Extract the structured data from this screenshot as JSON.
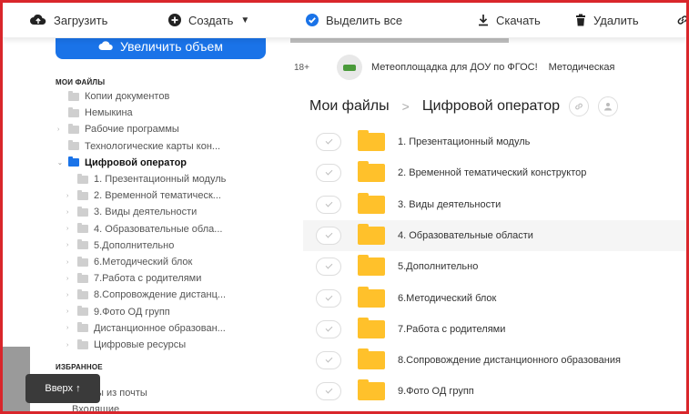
{
  "toolbar": {
    "upload": "Загрузить",
    "create": "Создать",
    "select_all": "Выделить все",
    "download": "Скачать",
    "delete": "Удалить"
  },
  "sidebar": {
    "upgrade_label": "Увеличить объем",
    "my_files_title": "МОИ ФАЙЛЫ",
    "items": [
      {
        "label": "Копии документов",
        "indent": 0,
        "arrow": false,
        "active": false
      },
      {
        "label": "Немыкина",
        "indent": 0,
        "arrow": false,
        "active": false
      },
      {
        "label": "Рабочие программы",
        "indent": 0,
        "arrow": true,
        "active": false
      },
      {
        "label": "Технологические карты кон...",
        "indent": 0,
        "arrow": false,
        "active": false
      },
      {
        "label": "Цифровой оператор",
        "indent": 0,
        "arrow": true,
        "active": true
      },
      {
        "label": "1. Презентационный модуль",
        "indent": 1,
        "arrow": false,
        "active": false
      },
      {
        "label": "2. Временной тематическ...",
        "indent": 1,
        "arrow": true,
        "active": false
      },
      {
        "label": "3. Виды деятельности",
        "indent": 1,
        "arrow": true,
        "active": false
      },
      {
        "label": "4. Образовательные обла...",
        "indent": 1,
        "arrow": true,
        "active": false
      },
      {
        "label": "5.Дополнительно",
        "indent": 1,
        "arrow": true,
        "active": false
      },
      {
        "label": "6.Методический блок",
        "indent": 1,
        "arrow": true,
        "active": false
      },
      {
        "label": "7.Работа с родителями",
        "indent": 1,
        "arrow": true,
        "active": false
      },
      {
        "label": "8.Сопровождение дистанц...",
        "indent": 1,
        "arrow": true,
        "active": false
      },
      {
        "label": "9.Фото ОД групп",
        "indent": 1,
        "arrow": true,
        "active": false
      },
      {
        "label": "Дистанционное образован...",
        "indent": 1,
        "arrow": true,
        "active": false
      },
      {
        "label": "Цифровые ресурсы",
        "indent": 1,
        "arrow": true,
        "active": false
      }
    ],
    "favorites_title": "ИЗБРАННОЕ",
    "fav_items": [
      "Файлы из почты",
      "Входящие"
    ],
    "up_button": "Вверх ↑"
  },
  "main": {
    "ad": {
      "age": "18+",
      "text": "Метеоплощадка для ДОУ по ФГОС!",
      "extra": "Методическая"
    },
    "breadcrumb": {
      "root": "Мои файлы",
      "separator": ">",
      "current": "Цифровой оператор"
    },
    "rows": [
      "1. Презентационный модуль",
      "2. Временной тематический конструктор",
      "3. Виды деятельности",
      "4. Образовательные области",
      "5.Дополнительно",
      "6.Методический блок",
      "7.Работа с родителями",
      "8.Сопровождение дистанционного образования",
      "9.Фото ОД групп"
    ],
    "highlighted_row": 3
  },
  "colors": {
    "accent": "#1a73e8",
    "folder": "#ffc12b",
    "frame_border": "#d9262b"
  }
}
